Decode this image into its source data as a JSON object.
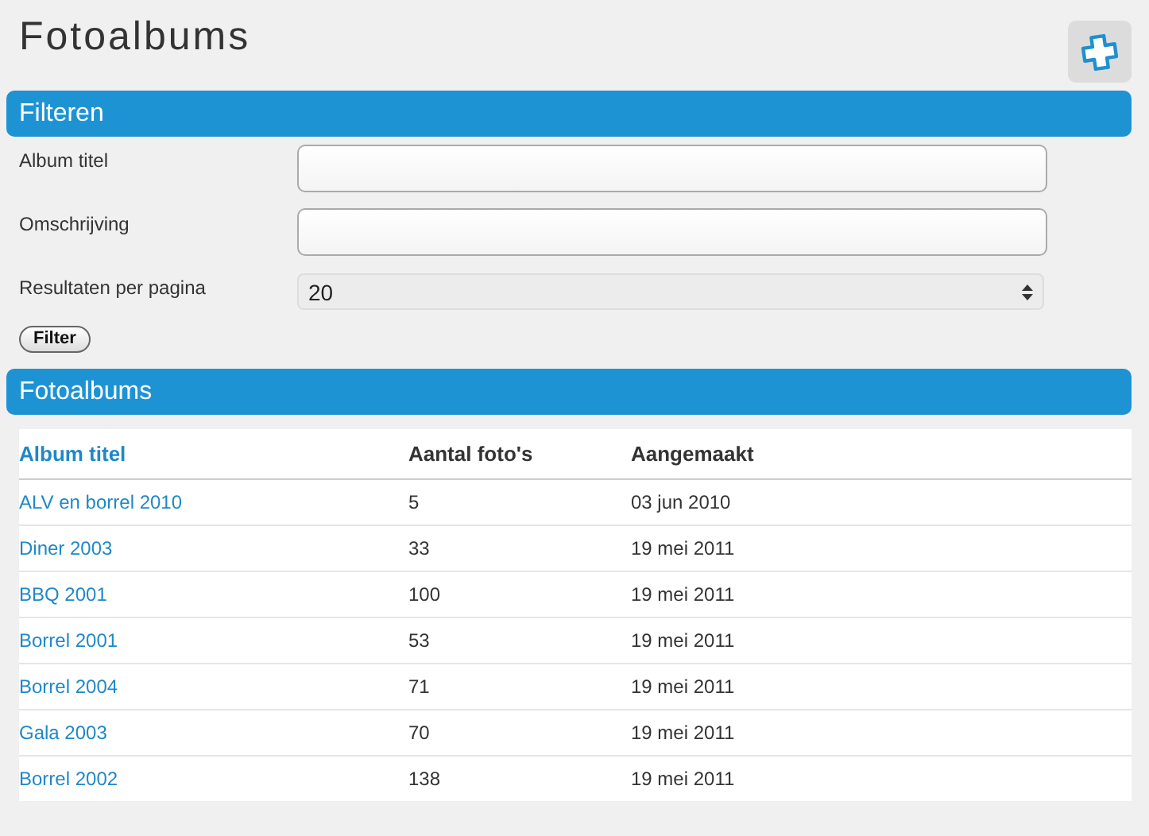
{
  "page_title": "Fotoalbums",
  "filter": {
    "title": "Filteren",
    "fields": [
      {
        "kind": "text",
        "label": "Album titel"
      },
      {
        "kind": "text",
        "label": "Omschrijving"
      },
      {
        "kind": "select",
        "label": "Resultaten per pagina",
        "value": "20"
      }
    ],
    "button": "Filter"
  },
  "albums": {
    "title": "Fotoalbums",
    "columns": [
      {
        "label": "Album titel",
        "sorted": true
      },
      {
        "label": "Aantal foto's",
        "sorted": false
      },
      {
        "label": "Aangemaakt",
        "sorted": false
      }
    ],
    "rows": [
      [
        "ALV en borrel 2010",
        "5",
        "03 jun 2010"
      ],
      [
        "Diner 2003",
        "33",
        "19 mei 2011"
      ],
      [
        "BBQ 2001",
        "100",
        "19 mei 2011"
      ],
      [
        "Borrel 2001",
        "53",
        "19 mei 2011"
      ],
      [
        "Borrel 2004",
        "71",
        "19 mei 2011"
      ],
      [
        "Gala 2003",
        "70",
        "19 mei 2011"
      ],
      [
        "Borrel 2002",
        "138",
        "19 mei 2011"
      ]
    ]
  }
}
